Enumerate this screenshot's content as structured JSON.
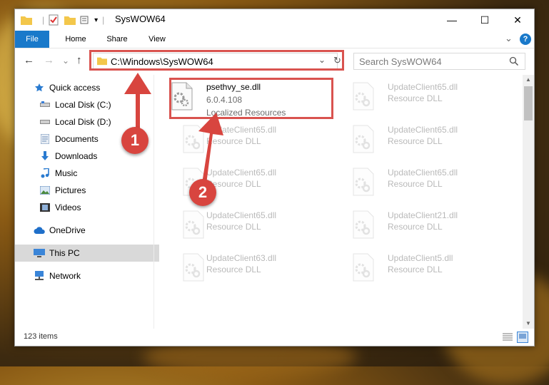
{
  "window": {
    "title": "SysWOW64",
    "controls": {
      "minimize": "—",
      "maximize": "☐",
      "close": "✕"
    }
  },
  "ribbon": {
    "tabs": [
      "File",
      "Home",
      "Share",
      "View"
    ],
    "expand_glyph": "⌄",
    "help_glyph": "?"
  },
  "nav": {
    "back": "←",
    "forward": "→",
    "recent": "⌄",
    "up": "↑",
    "address": "C:\\Windows\\SysWOW64",
    "address_dropdown": "⌄",
    "refresh": "↻",
    "search_placeholder": "Search SysWOW64",
    "search_icon": "magnifier-icon"
  },
  "sidebar": {
    "items": [
      {
        "label": "Quick access",
        "icon": "star-icon",
        "pinned": false
      },
      {
        "label": "Local Disk (C:)",
        "icon": "drive-icon",
        "pinned": true
      },
      {
        "label": "Local Disk (D:)",
        "icon": "drive-icon",
        "pinned": true
      },
      {
        "label": "Documents",
        "icon": "documents-icon",
        "pinned": true
      },
      {
        "label": "Downloads",
        "icon": "download-icon",
        "pinned": true
      },
      {
        "label": "Music",
        "icon": "music-icon",
        "pinned": true
      },
      {
        "label": "Pictures",
        "icon": "pictures-icon",
        "pinned": true
      },
      {
        "label": "Videos",
        "icon": "videos-icon",
        "pinned": true
      },
      {
        "label": "OneDrive",
        "icon": "cloud-icon",
        "pinned": false
      },
      {
        "label": "This PC",
        "icon": "pc-icon",
        "pinned": false,
        "selected": true
      },
      {
        "label": "Network",
        "icon": "network-icon",
        "pinned": false
      }
    ]
  },
  "files": [
    {
      "name": "psethvy_se.dll",
      "line2": "6.0.4.108",
      "line3": "Localized Resources",
      "highlight": true
    },
    {
      "name": "UpdateClient65.dll",
      "line2": "Resource DLL"
    },
    {
      "name": "UpdateClient65.dll",
      "line2": "Resource DLL"
    },
    {
      "name": "UpdateClient65.dll",
      "line2": "Resource DLL"
    },
    {
      "name": "UpdateClient65.dll",
      "line2": "Resource DLL"
    },
    {
      "name": "UpdateClient65.dll",
      "line2": "Resource DLL"
    },
    {
      "name": "UpdateClient65.dll",
      "line2": "Resource DLL"
    },
    {
      "name": "UpdateClient21.dll",
      "line2": "Resource DLL"
    },
    {
      "name": "UpdateClient63.dll",
      "line2": "Resource DLL"
    },
    {
      "name": "UpdateClient5.dll",
      "line2": "Resource DLL"
    }
  ],
  "status": {
    "item_count": "123 items"
  },
  "annotations": {
    "step1": "1",
    "step2": "2"
  },
  "colors": {
    "accent": "#1979ca",
    "annotation": "#d8453f",
    "selection": "#d9d9d9"
  }
}
